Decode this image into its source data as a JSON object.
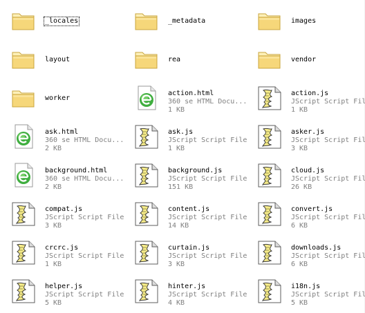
{
  "items": [
    {
      "name": "_locales",
      "type": "folder",
      "focused": true
    },
    {
      "name": "_metadata",
      "type": "folder"
    },
    {
      "name": "images",
      "type": "folder"
    },
    {
      "name": "layout",
      "type": "folder"
    },
    {
      "name": "rea",
      "type": "folder"
    },
    {
      "name": "vendor",
      "type": "folder"
    },
    {
      "name": "worker",
      "type": "folder"
    },
    {
      "name": "action.html",
      "type": "html",
      "kind": "360 se HTML Docu...",
      "size": "1 KB"
    },
    {
      "name": "action.js",
      "type": "js",
      "kind": "JScript Script File",
      "size": "1 KB"
    },
    {
      "name": "ask.html",
      "type": "html",
      "kind": "360 se HTML Docu...",
      "size": "2 KB"
    },
    {
      "name": "ask.js",
      "type": "js",
      "kind": "JScript Script File",
      "size": "1 KB"
    },
    {
      "name": "asker.js",
      "type": "js",
      "kind": "JScript Script File",
      "size": "3 KB"
    },
    {
      "name": "background.html",
      "type": "html",
      "kind": "360 se HTML Docu...",
      "size": "2 KB"
    },
    {
      "name": "background.js",
      "type": "js",
      "kind": "JScript Script File",
      "size": "151 KB"
    },
    {
      "name": "cloud.js",
      "type": "js",
      "kind": "JScript Script File",
      "size": "26 KB"
    },
    {
      "name": "compat.js",
      "type": "js",
      "kind": "JScript Script File",
      "size": "3 KB"
    },
    {
      "name": "content.js",
      "type": "js",
      "kind": "JScript Script File",
      "size": "14 KB"
    },
    {
      "name": "convert.js",
      "type": "js",
      "kind": "JScript Script File",
      "size": "6 KB"
    },
    {
      "name": "crcrc.js",
      "type": "js",
      "kind": "JScript Script File",
      "size": "1 KB"
    },
    {
      "name": "curtain.js",
      "type": "js",
      "kind": "JScript Script File",
      "size": "3 KB"
    },
    {
      "name": "downloads.js",
      "type": "js",
      "kind": "JScript Script File",
      "size": "6 KB"
    },
    {
      "name": "helper.js",
      "type": "js",
      "kind": "JScript Script File",
      "size": "5 KB"
    },
    {
      "name": "hinter.js",
      "type": "js",
      "kind": "JScript Script File",
      "size": "4 KB"
    },
    {
      "name": "i18n.js",
      "type": "js",
      "kind": "JScript Script File",
      "size": "5 KB"
    }
  ],
  "colors": {
    "folder_body": "#f6d77a",
    "folder_light": "#fdf0b8",
    "folder_edge": "#c9a43c",
    "html_globe": "#3fae3f",
    "html_globe_light": "#8fdc7a",
    "js_scroll": "#f7ec8a",
    "meta_text": "#7f7f7f"
  },
  "icons": {
    "folder": "folder-icon",
    "html": "html-document-icon",
    "js": "jscript-file-icon"
  }
}
